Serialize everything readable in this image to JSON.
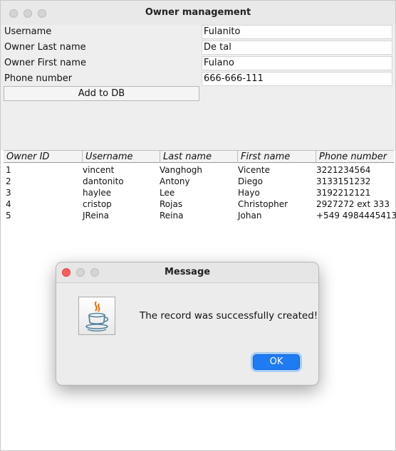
{
  "window": {
    "title": "Owner management"
  },
  "form": {
    "username_label": "Username",
    "username_value": "Fulanito",
    "last_name_label": "Owner Last name",
    "last_name_value": "De tal",
    "first_name_label": "Owner First name",
    "first_name_value": "Fulano",
    "phone_label": "Phone number",
    "phone_value": "666-666-111",
    "add_button": "Add to DB"
  },
  "table": {
    "columns": [
      "Owner ID",
      "Username",
      "Last name",
      "First name",
      "Phone number"
    ],
    "rows": [
      [
        "1",
        "vincent",
        "Vanghogh",
        "Vicente",
        "3221234564"
      ],
      [
        "2",
        "dantonito",
        "Antony",
        "Diego",
        "3133151232"
      ],
      [
        "3",
        "haylee",
        "Lee",
        "Hayo",
        "3192212121"
      ],
      [
        "4",
        "cristop",
        "Rojas",
        "Christopher",
        "2927272 ext 333"
      ],
      [
        "5",
        "JReina",
        "Reina",
        "Johan",
        "+549 4984445413"
      ]
    ]
  },
  "dialog": {
    "title": "Message",
    "message": "The record was successfully created!",
    "ok_label": "OK",
    "icon": "java-icon"
  },
  "colors": {
    "accent": "#1f7bf2",
    "close_button": "#ff5f57"
  }
}
